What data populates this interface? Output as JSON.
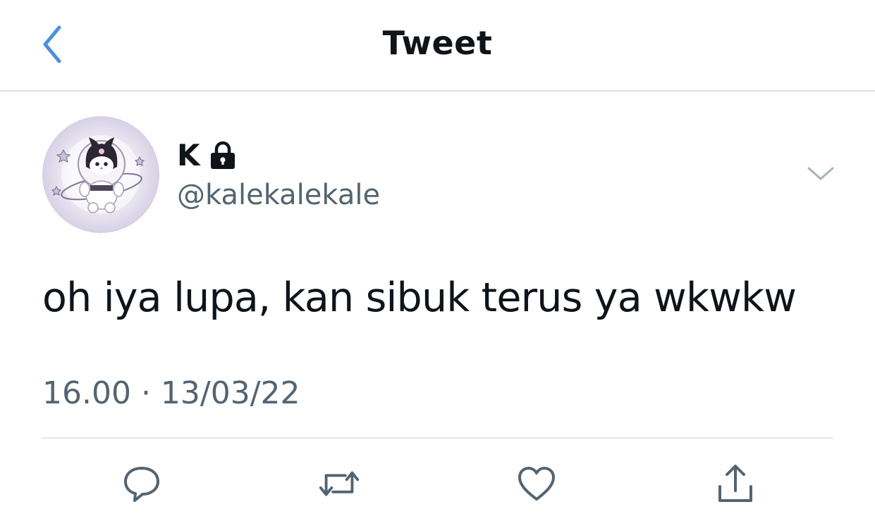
{
  "header": {
    "back_icon": "chevron-left-icon",
    "title": "Tweet",
    "accent_color": "#4a90e2"
  },
  "user": {
    "display_name": "K",
    "protected_icon": "lock-icon",
    "handle": "@kalekalekale",
    "avatar_icon": "avatar-image"
  },
  "tweet": {
    "text": "oh iya lupa, kan sibuk terus ya wkwkw",
    "timestamp": "16.00 · 13/03/22",
    "more_icon": "chevron-down-icon"
  },
  "actions": [
    {
      "name": "reply",
      "icon": "reply-icon"
    },
    {
      "name": "retweet",
      "icon": "retweet-icon"
    },
    {
      "name": "like",
      "icon": "heart-icon"
    },
    {
      "name": "share",
      "icon": "share-icon"
    }
  ],
  "colors": {
    "text_primary": "#0f1419",
    "text_secondary": "#536471",
    "divider": "#e4e7ea"
  }
}
